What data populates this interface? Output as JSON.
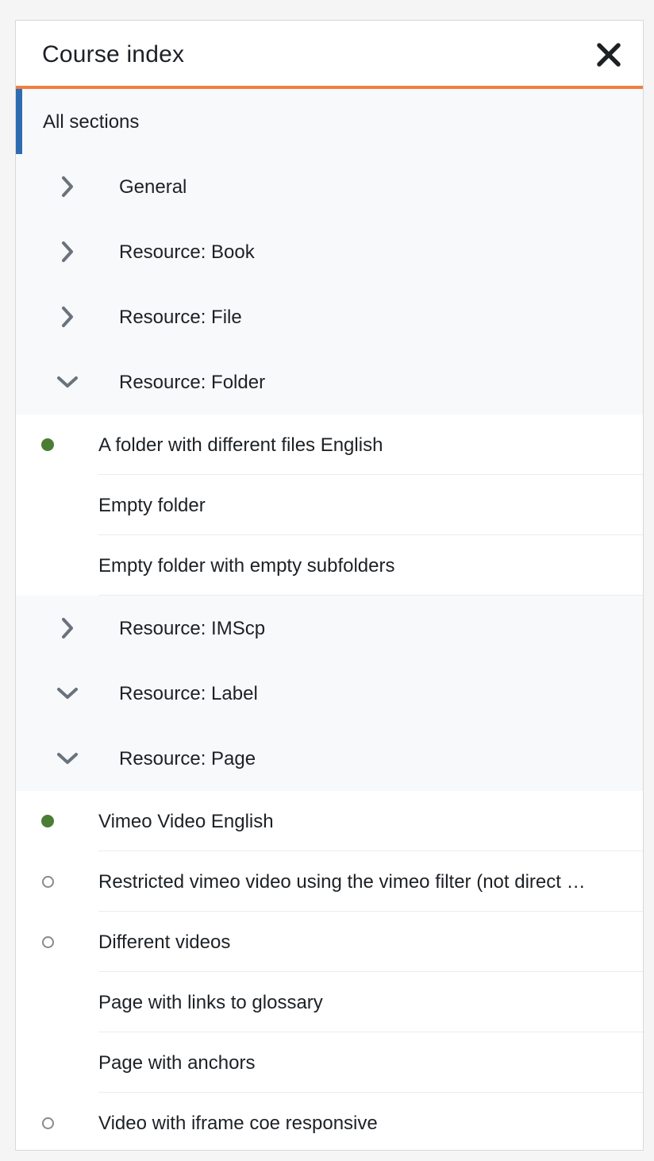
{
  "drawer": {
    "title": "Course index",
    "close_icon": "close-icon",
    "accent_color": "#f07e3f",
    "selected_color": "#2f6bb0"
  },
  "all_sections": {
    "label": "All sections"
  },
  "sections": [
    {
      "label": "General",
      "expanded": false,
      "activities": []
    },
    {
      "label": "Resource: Book",
      "expanded": false,
      "activities": []
    },
    {
      "label": "Resource: File",
      "expanded": false,
      "activities": []
    },
    {
      "label": "Resource: Folder",
      "expanded": true,
      "activities": [
        {
          "label": "A folder with different files English",
          "completion": "complete"
        },
        {
          "label": "Empty folder",
          "completion": "none"
        },
        {
          "label": "Empty folder with empty subfolders",
          "completion": "none"
        }
      ]
    },
    {
      "label": "Resource: IMScp",
      "expanded": false,
      "activities": []
    },
    {
      "label": "Resource: Label",
      "expanded": true,
      "activities": []
    },
    {
      "label": "Resource: Page",
      "expanded": true,
      "activities": [
        {
          "label": "Vimeo Video English",
          "completion": "complete"
        },
        {
          "label": "Restricted vimeo video using the vimeo filter (not direct …",
          "completion": "incomplete"
        },
        {
          "label": "Different videos",
          "completion": "incomplete"
        },
        {
          "label": "Page with links to glossary",
          "completion": "none"
        },
        {
          "label": "Page with anchors",
          "completion": "none"
        },
        {
          "label": "Video with iframe coe responsive",
          "completion": "incomplete"
        }
      ]
    }
  ],
  "colors": {
    "complete": "#4b7d35",
    "incomplete_border": "#8a8a8a"
  }
}
